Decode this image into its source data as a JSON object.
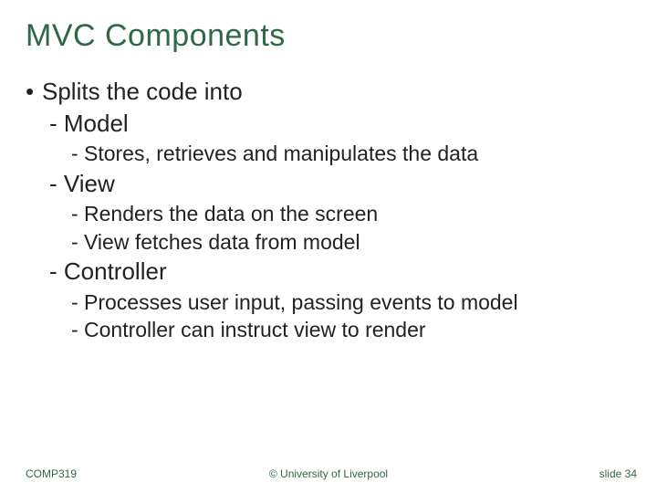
{
  "title": "MVC Components",
  "bullets": {
    "top": "Splits the code into",
    "model": {
      "label": "Model",
      "sub": [
        "Stores, retrieves and manipulates the data"
      ]
    },
    "view": {
      "label": "View",
      "sub": [
        "Renders the data on the screen",
        "View fetches data from model"
      ]
    },
    "controller": {
      "label": "Controller",
      "sub": [
        "Processes user input, passing events to model",
        "Controller can instruct view to render"
      ]
    }
  },
  "footer": {
    "left": "COMP319",
    "center": "© University of Liverpool",
    "right": "slide  34"
  },
  "colors": {
    "accent": "#2f6845"
  }
}
